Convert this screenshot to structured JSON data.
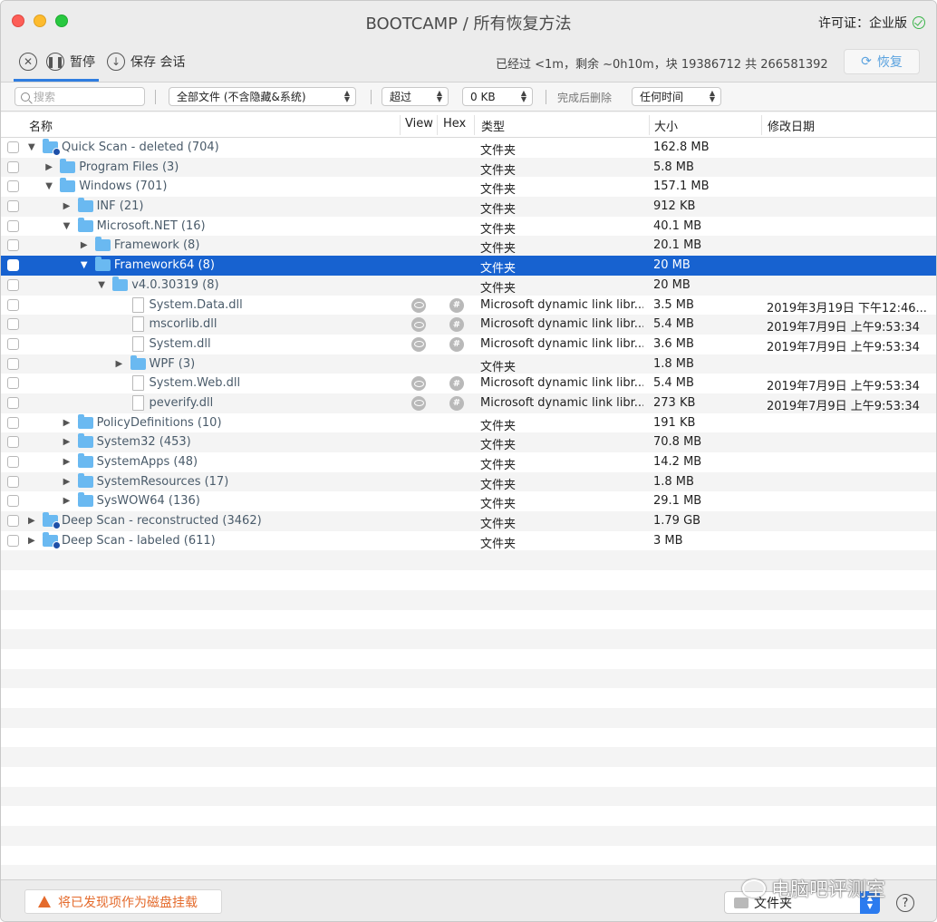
{
  "window": {
    "title": "BOOTCAMP / 所有恢复方法",
    "license_label": "许可证：企业版"
  },
  "toolbar": {
    "pause_label": "暂停",
    "save_session_label": "保存 会话",
    "progress": "已经过 <1m，剩余 ~0h10m，块 19386712 共 266581392",
    "restore_label": "恢复"
  },
  "filter": {
    "search_placeholder": "搜索",
    "file_filter": "全部文件 (不含隐藏&系统)",
    "size_op": "超过",
    "size_value": "0 KB",
    "after_label": "完成后删除",
    "time": "任何时间"
  },
  "table": {
    "headers": {
      "name": "名称",
      "view": "View",
      "hex": "Hex",
      "type": "类型",
      "size": "大小",
      "date": "修改日期"
    },
    "rows": [
      {
        "level": 0,
        "disc": "▼",
        "icon": "folder-badge",
        "name": "Quick Scan - deleted (704)",
        "type": "文件夹",
        "size": "162.8 MB",
        "date": ""
      },
      {
        "level": 1,
        "disc": "▶",
        "icon": "folder",
        "name": "Program Files (3)",
        "type": "文件夹",
        "size": "5.8 MB",
        "date": ""
      },
      {
        "level": 1,
        "disc": "▼",
        "icon": "folder",
        "name": "Windows (701)",
        "type": "文件夹",
        "size": "157.1 MB",
        "date": ""
      },
      {
        "level": 2,
        "disc": "▶",
        "icon": "folder",
        "name": "INF (21)",
        "type": "文件夹",
        "size": "912 KB",
        "date": ""
      },
      {
        "level": 2,
        "disc": "▼",
        "icon": "folder",
        "name": "Microsoft.NET (16)",
        "type": "文件夹",
        "size": "40.1 MB",
        "date": ""
      },
      {
        "level": 3,
        "disc": "▶",
        "icon": "folder",
        "name": "Framework (8)",
        "type": "文件夹",
        "size": "20.1 MB",
        "date": ""
      },
      {
        "level": 3,
        "disc": "▼",
        "icon": "folder",
        "name": "Framework64 (8)",
        "type": "文件夹",
        "size": "20 MB",
        "date": "",
        "selected": true
      },
      {
        "level": 4,
        "disc": "▼",
        "icon": "folder",
        "name": "v4.0.30319 (8)",
        "type": "文件夹",
        "size": "20 MB",
        "date": ""
      },
      {
        "level": 5,
        "disc": "",
        "icon": "file",
        "name": "System.Data.dll",
        "type": "Microsoft dynamic link libr...",
        "size": "3.5 MB",
        "date": "2019年3月19日 下午12:46...",
        "preview": true
      },
      {
        "level": 5,
        "disc": "",
        "icon": "file",
        "name": "mscorlib.dll",
        "type": "Microsoft dynamic link libr...",
        "size": "5.4 MB",
        "date": "2019年7月9日 上午9:53:34",
        "preview": true
      },
      {
        "level": 5,
        "disc": "",
        "icon": "file",
        "name": "System.dll",
        "type": "Microsoft dynamic link libr...",
        "size": "3.6 MB",
        "date": "2019年7月9日 上午9:53:34",
        "preview": true
      },
      {
        "level": 5,
        "disc": "▶",
        "icon": "folder",
        "name": "WPF (3)",
        "type": "文件夹",
        "size": "1.8 MB",
        "date": ""
      },
      {
        "level": 5,
        "disc": "",
        "icon": "file",
        "name": "System.Web.dll",
        "type": "Microsoft dynamic link libr...",
        "size": "5.4 MB",
        "date": "2019年7月9日 上午9:53:34",
        "preview": true
      },
      {
        "level": 5,
        "disc": "",
        "icon": "file",
        "name": "peverify.dll",
        "type": "Microsoft dynamic link libr...",
        "size": "273 KB",
        "date": "2019年7月9日 上午9:53:34",
        "preview": true
      },
      {
        "level": 2,
        "disc": "▶",
        "icon": "folder",
        "name": "PolicyDefinitions (10)",
        "type": "文件夹",
        "size": "191 KB",
        "date": ""
      },
      {
        "level": 2,
        "disc": "▶",
        "icon": "folder",
        "name": "System32 (453)",
        "type": "文件夹",
        "size": "70.8 MB",
        "date": ""
      },
      {
        "level": 2,
        "disc": "▶",
        "icon": "folder",
        "name": "SystemApps (48)",
        "type": "文件夹",
        "size": "14.2 MB",
        "date": ""
      },
      {
        "level": 2,
        "disc": "▶",
        "icon": "folder",
        "name": "SystemResources (17)",
        "type": "文件夹",
        "size": "1.8 MB",
        "date": ""
      },
      {
        "level": 2,
        "disc": "▶",
        "icon": "folder",
        "name": "SysWOW64 (136)",
        "type": "文件夹",
        "size": "29.1 MB",
        "date": ""
      },
      {
        "level": 0,
        "disc": "▶",
        "icon": "folder-badge",
        "name": "Deep Scan - reconstructed (3462)",
        "type": "文件夹",
        "size": "1.79 GB",
        "date": ""
      },
      {
        "level": 0,
        "disc": "▶",
        "icon": "folder-badge",
        "name": "Deep Scan - labeled (611)",
        "type": "文件夹",
        "size": "3 MB",
        "date": ""
      }
    ]
  },
  "bottom": {
    "mount_label": "将已发现项作为磁盘挂载",
    "destination": "文件夹",
    "help": "?",
    "watermark": "电脑吧评测室"
  },
  "colors": {
    "selection": "#1762d0",
    "folder": "#6ab9f1",
    "accent": "#2f7de0",
    "warning": "#e46b2d"
  }
}
